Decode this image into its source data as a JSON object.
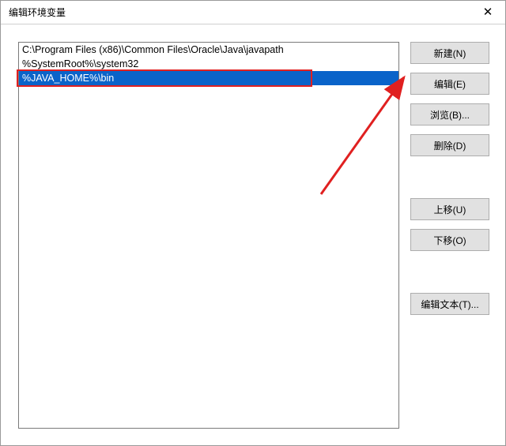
{
  "window": {
    "title": "编辑环境变量"
  },
  "list": {
    "items": [
      "C:\\Program Files (x86)\\Common Files\\Oracle\\Java\\javapath",
      "%SystemRoot%\\system32",
      "%JAVA_HOME%\\bin"
    ],
    "selected_index": 2
  },
  "buttons": {
    "new": "新建(N)",
    "edit": "编辑(E)",
    "browse": "浏览(B)...",
    "delete": "删除(D)",
    "moveup": "上移(U)",
    "movedown": "下移(O)",
    "edittext": "编辑文本(T)..."
  }
}
